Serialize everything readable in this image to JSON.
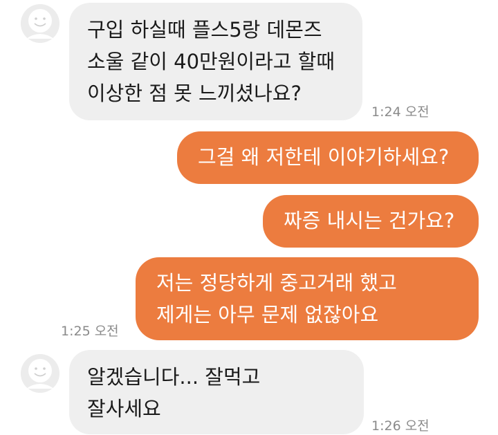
{
  "messages": [
    {
      "sender": "other",
      "text": "구입 하실때  플스5랑 데몬즈\n소울 같이 40만원이라고 할때\n이상한 점  못 느끼셨나요?",
      "time": "1:24 오전"
    },
    {
      "sender": "me",
      "text": "그걸 왜 저한테 이야기하세요?"
    },
    {
      "sender": "me",
      "text": "짜증 내시는 건가요?"
    },
    {
      "sender": "me",
      "text": "저는 정당하게 중고거래 했고\n제게는 아무 문제 없잖아요",
      "time": "1:25 오전"
    },
    {
      "sender": "other",
      "text": "알겠습니다... 잘먹고\n잘사세요",
      "time": "1:26 오전"
    }
  ],
  "colors": {
    "incoming_bubble": "#efefef",
    "outgoing_bubble": "#ec7c3f",
    "timestamp": "#8a8a8a",
    "avatar_bg": "#eeeeee"
  },
  "icons": {
    "avatar": "default-profile-smiley-icon"
  }
}
